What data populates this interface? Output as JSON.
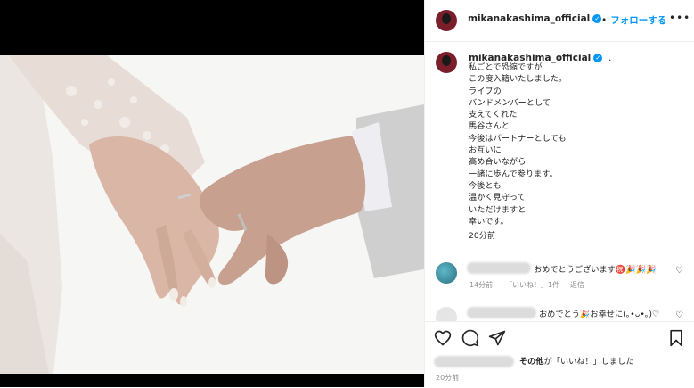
{
  "post": {
    "username": "mikanakashima_official",
    "follow_label": "フォローする",
    "more_label": "•••",
    "caption_dot": ".",
    "caption_lines": [
      "私ごとで恐縮ですが",
      "この度入籍いたしました。",
      "ライブの",
      "バンドメンバーとして",
      "支えてくれた",
      "馬谷さんと",
      "今後はパートナーとしても",
      "お互いに",
      "高め合いながら",
      "一緒に歩んで参ります。",
      "今後とも",
      "温かく見守って",
      "いただけますと",
      "幸いです。"
    ],
    "caption_time": "20分前",
    "post_time": "20分前"
  },
  "comments": [
    {
      "text": "おめでとうございます㊗️🎉🎉🎉",
      "time": "14分前",
      "likes": "「いいね！」1件",
      "reply": "返信"
    },
    {
      "text": "おめでとう🎉お幸せに(｡•ᴗ•｡)♡"
    }
  ],
  "likes_line": {
    "bold": "その他",
    "text": "が「いいね！」しました"
  },
  "colors": {
    "accent": "#0095f6",
    "text": "#262626",
    "muted": "#8e8e8e"
  }
}
